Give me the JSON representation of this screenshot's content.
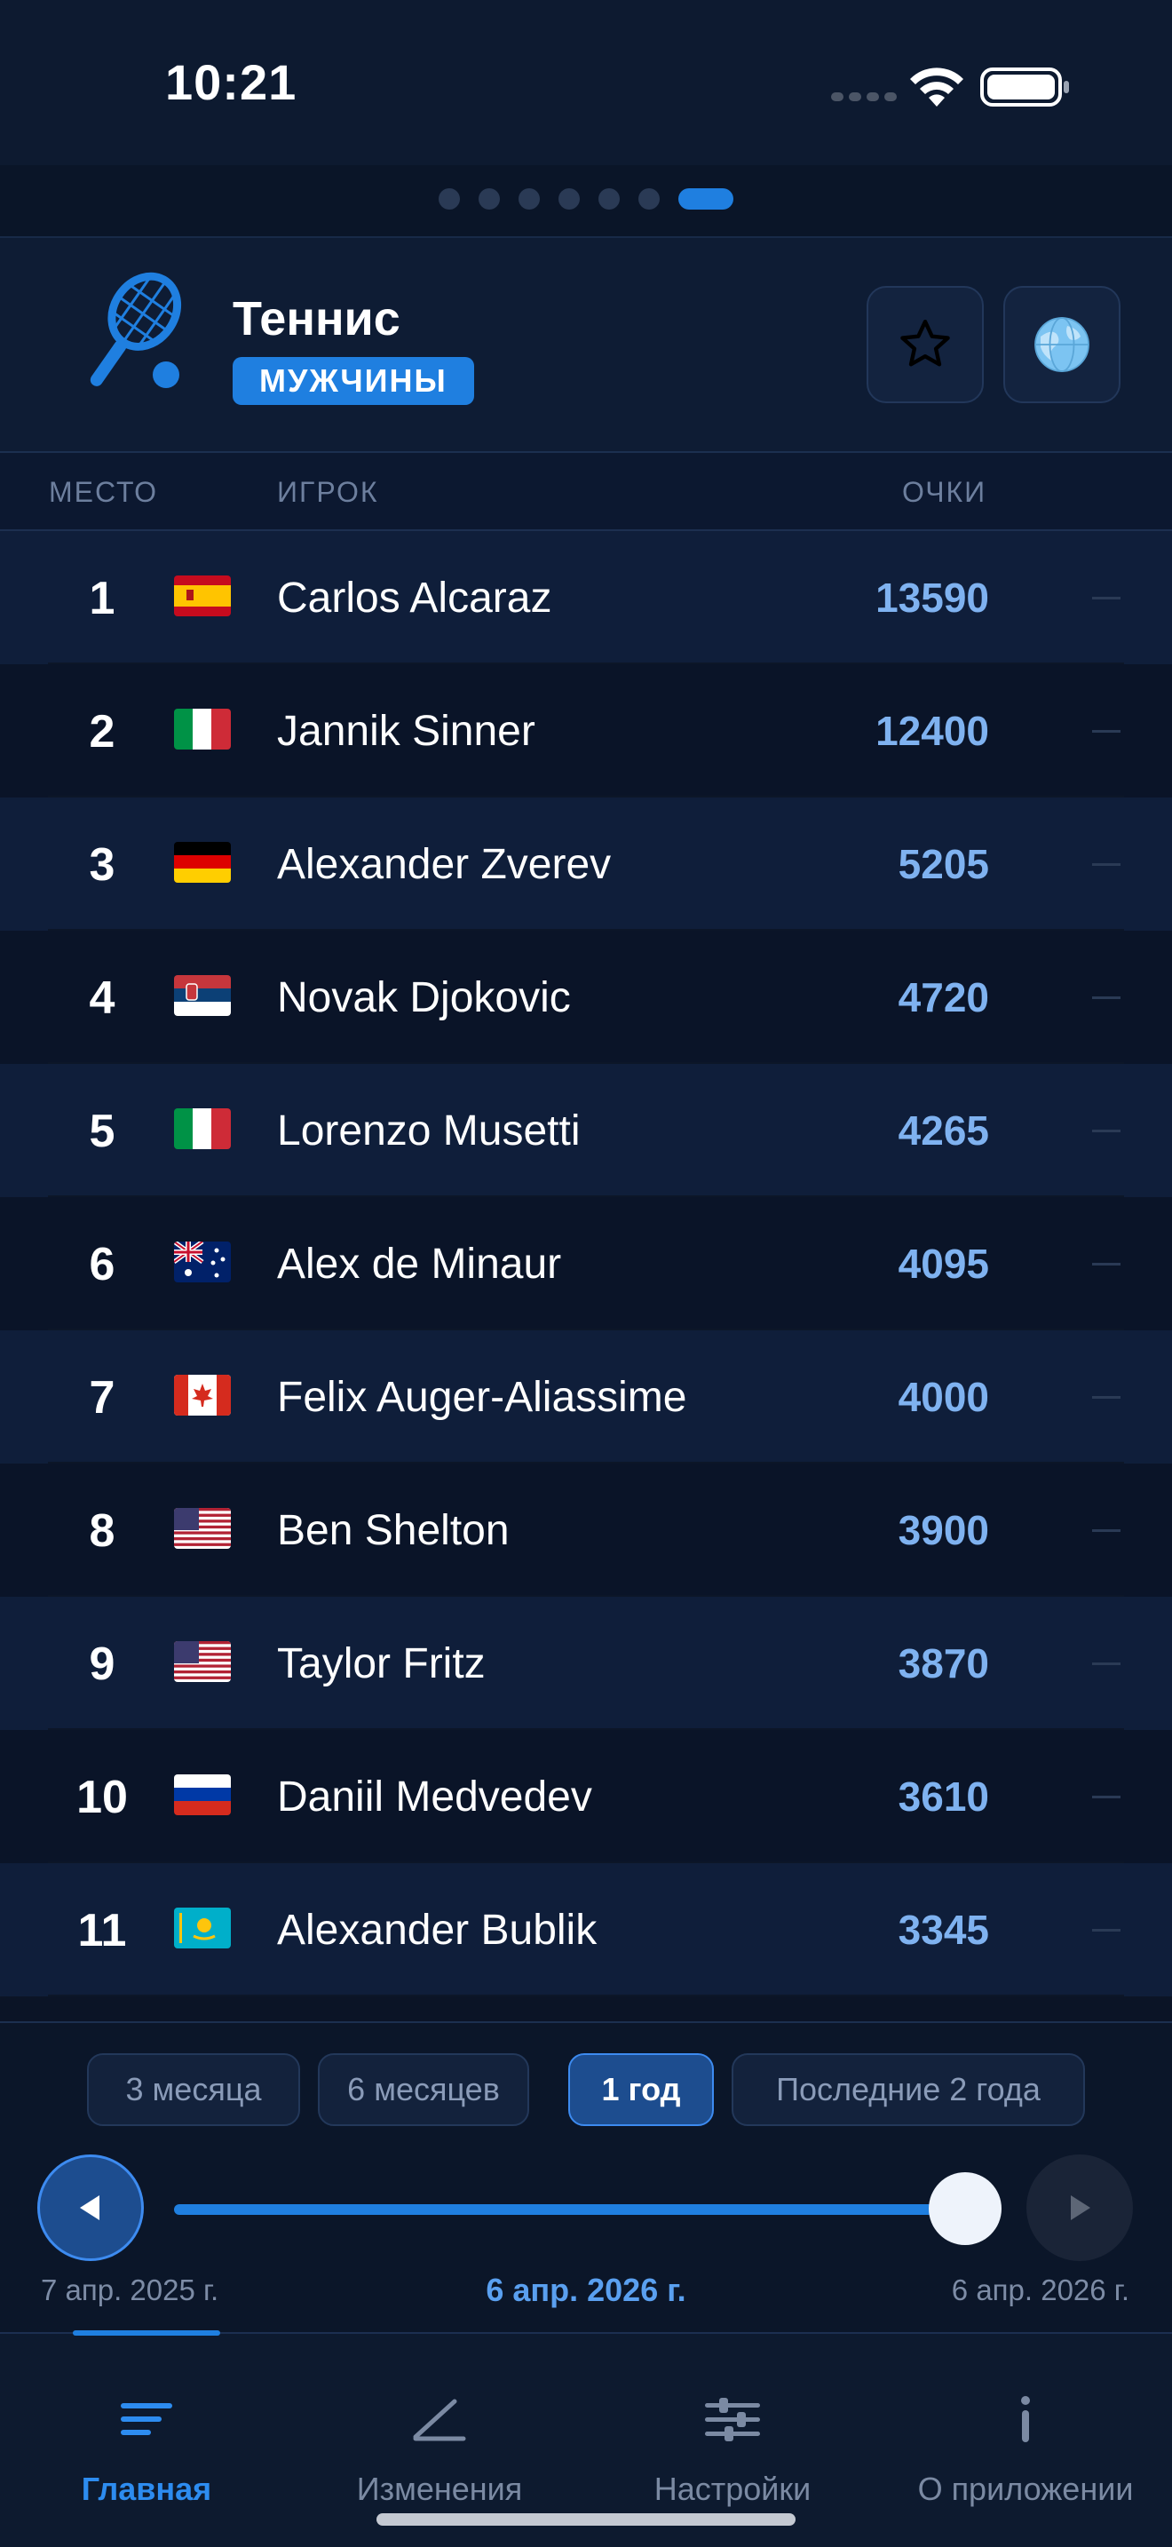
{
  "status": {
    "time": "10:21"
  },
  "pager": {
    "count": 7,
    "active_index": 6
  },
  "header": {
    "title": "Теннис",
    "badge": "МУЖЧИНЫ",
    "favorite_icon": "star-icon",
    "globe_icon": "globe-icon"
  },
  "columns": {
    "rank": "МЕСТО",
    "player": "ИГРОК",
    "points": "ОЧКИ"
  },
  "rankings": [
    {
      "rank": "1",
      "flag": "spain",
      "name": "Carlos Alcaraz",
      "points": "13590",
      "change": "—"
    },
    {
      "rank": "2",
      "flag": "italy",
      "name": "Jannik Sinner",
      "points": "12400",
      "change": "—"
    },
    {
      "rank": "3",
      "flag": "germany",
      "name": "Alexander Zverev",
      "points": "5205",
      "change": "—"
    },
    {
      "rank": "4",
      "flag": "serbia",
      "name": "Novak Djokovic",
      "points": "4720",
      "change": "—"
    },
    {
      "rank": "5",
      "flag": "italy",
      "name": "Lorenzo Musetti",
      "points": "4265",
      "change": "—"
    },
    {
      "rank": "6",
      "flag": "australia",
      "name": "Alex de Minaur",
      "points": "4095",
      "change": "—"
    },
    {
      "rank": "7",
      "flag": "canada",
      "name": "Felix Auger-Aliassime",
      "points": "4000",
      "change": "—"
    },
    {
      "rank": "8",
      "flag": "usa",
      "name": "Ben Shelton",
      "points": "3900",
      "change": "—"
    },
    {
      "rank": "9",
      "flag": "usa",
      "name": "Taylor Fritz",
      "points": "3870",
      "change": "—"
    },
    {
      "rank": "10",
      "flag": "russia",
      "name": "Daniil Medvedev",
      "points": "3610",
      "change": "—"
    },
    {
      "rank": "11",
      "flag": "kazakhstan",
      "name": "Alexander Bublik",
      "points": "3345",
      "change": "—"
    }
  ],
  "periods": {
    "items": [
      "3 месяца",
      "6 месяцев",
      "1 год",
      "Последние 2 года"
    ],
    "selected": "1 год"
  },
  "timeline": {
    "start_label": "7 апр. 2025 г.",
    "current_label": "6 апр. 2026 г.",
    "end_label": "6 апр. 2026 г.",
    "progress": 1.0,
    "play_icon": "rewind-play-icon",
    "next_icon": "play-icon"
  },
  "tabs": [
    {
      "label": "Главная",
      "icon": "list-icon",
      "active": true
    },
    {
      "label": "Изменения",
      "icon": "chart-line-icon",
      "active": false
    },
    {
      "label": "Настройки",
      "icon": "sliders-icon",
      "active": false
    },
    {
      "label": "О приложении",
      "icon": "info-icon",
      "active": false
    }
  ],
  "colors": {
    "accent": "#1f7fe0",
    "points": "#7fb2f0",
    "background": "#0b1426"
  }
}
